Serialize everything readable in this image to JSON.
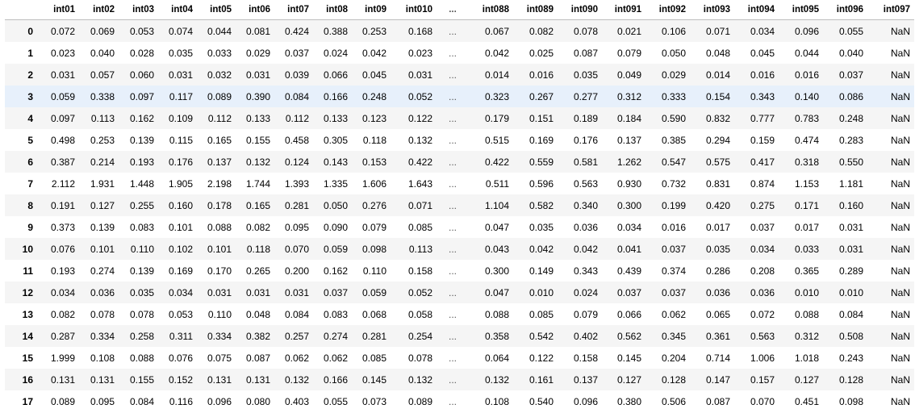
{
  "columns": [
    "int01",
    "int02",
    "int03",
    "int04",
    "int05",
    "int06",
    "int07",
    "int08",
    "int09",
    "int010",
    "...",
    "int088",
    "int089",
    "int090",
    "int091",
    "int092",
    "int093",
    "int094",
    "int095",
    "int096",
    "int097"
  ],
  "rows": [
    {
      "index": "0",
      "cells": [
        "0.072",
        "0.069",
        "0.053",
        "0.074",
        "0.044",
        "0.081",
        "0.424",
        "0.388",
        "0.253",
        "0.168",
        "...",
        "0.067",
        "0.082",
        "0.078",
        "0.021",
        "0.106",
        "0.071",
        "0.034",
        "0.096",
        "0.055",
        "NaN"
      ]
    },
    {
      "index": "1",
      "cells": [
        "0.023",
        "0.040",
        "0.028",
        "0.035",
        "0.033",
        "0.029",
        "0.037",
        "0.024",
        "0.042",
        "0.023",
        "...",
        "0.042",
        "0.025",
        "0.087",
        "0.079",
        "0.050",
        "0.048",
        "0.045",
        "0.044",
        "0.040",
        "NaN"
      ]
    },
    {
      "index": "2",
      "cells": [
        "0.031",
        "0.057",
        "0.060",
        "0.031",
        "0.032",
        "0.031",
        "0.039",
        "0.066",
        "0.045",
        "0.031",
        "...",
        "0.014",
        "0.016",
        "0.035",
        "0.049",
        "0.029",
        "0.014",
        "0.016",
        "0.016",
        "0.037",
        "NaN"
      ]
    },
    {
      "index": "3",
      "cells": [
        "0.059",
        "0.338",
        "0.097",
        "0.117",
        "0.089",
        "0.390",
        "0.084",
        "0.166",
        "0.248",
        "0.052",
        "...",
        "0.323",
        "0.267",
        "0.277",
        "0.312",
        "0.333",
        "0.154",
        "0.343",
        "0.140",
        "0.086",
        "NaN"
      ]
    },
    {
      "index": "4",
      "cells": [
        "0.097",
        "0.113",
        "0.162",
        "0.109",
        "0.112",
        "0.133",
        "0.112",
        "0.133",
        "0.123",
        "0.122",
        "...",
        "0.179",
        "0.151",
        "0.189",
        "0.184",
        "0.590",
        "0.832",
        "0.777",
        "0.783",
        "0.248",
        "NaN"
      ]
    },
    {
      "index": "5",
      "cells": [
        "0.498",
        "0.253",
        "0.139",
        "0.115",
        "0.165",
        "0.155",
        "0.458",
        "0.305",
        "0.118",
        "0.132",
        "...",
        "0.515",
        "0.169",
        "0.176",
        "0.137",
        "0.385",
        "0.294",
        "0.159",
        "0.474",
        "0.283",
        "NaN"
      ]
    },
    {
      "index": "6",
      "cells": [
        "0.387",
        "0.214",
        "0.193",
        "0.176",
        "0.137",
        "0.132",
        "0.124",
        "0.143",
        "0.153",
        "0.422",
        "...",
        "0.422",
        "0.559",
        "0.581",
        "1.262",
        "0.547",
        "0.575",
        "0.417",
        "0.318",
        "0.550",
        "NaN"
      ]
    },
    {
      "index": "7",
      "cells": [
        "2.112",
        "1.931",
        "1.448",
        "1.905",
        "2.198",
        "1.744",
        "1.393",
        "1.335",
        "1.606",
        "1.643",
        "...",
        "0.511",
        "0.596",
        "0.563",
        "0.930",
        "0.732",
        "0.831",
        "0.874",
        "1.153",
        "1.181",
        "NaN"
      ]
    },
    {
      "index": "8",
      "cells": [
        "0.191",
        "0.127",
        "0.255",
        "0.160",
        "0.178",
        "0.165",
        "0.281",
        "0.050",
        "0.276",
        "0.071",
        "...",
        "1.104",
        "0.582",
        "0.340",
        "0.300",
        "0.199",
        "0.420",
        "0.275",
        "0.171",
        "0.160",
        "NaN"
      ]
    },
    {
      "index": "9",
      "cells": [
        "0.373",
        "0.139",
        "0.083",
        "0.101",
        "0.088",
        "0.082",
        "0.095",
        "0.090",
        "0.079",
        "0.085",
        "...",
        "0.047",
        "0.035",
        "0.036",
        "0.034",
        "0.016",
        "0.017",
        "0.037",
        "0.017",
        "0.031",
        "NaN"
      ]
    },
    {
      "index": "10",
      "cells": [
        "0.076",
        "0.101",
        "0.110",
        "0.102",
        "0.101",
        "0.118",
        "0.070",
        "0.059",
        "0.098",
        "0.113",
        "...",
        "0.043",
        "0.042",
        "0.042",
        "0.041",
        "0.037",
        "0.035",
        "0.034",
        "0.033",
        "0.031",
        "NaN"
      ]
    },
    {
      "index": "11",
      "cells": [
        "0.193",
        "0.274",
        "0.139",
        "0.169",
        "0.170",
        "0.265",
        "0.200",
        "0.162",
        "0.110",
        "0.158",
        "...",
        "0.300",
        "0.149",
        "0.343",
        "0.439",
        "0.374",
        "0.286",
        "0.208",
        "0.365",
        "0.289",
        "NaN"
      ]
    },
    {
      "index": "12",
      "cells": [
        "0.034",
        "0.036",
        "0.035",
        "0.034",
        "0.031",
        "0.031",
        "0.031",
        "0.037",
        "0.059",
        "0.052",
        "...",
        "0.047",
        "0.010",
        "0.024",
        "0.037",
        "0.037",
        "0.036",
        "0.036",
        "0.010",
        "0.010",
        "NaN"
      ]
    },
    {
      "index": "13",
      "cells": [
        "0.082",
        "0.078",
        "0.078",
        "0.053",
        "0.110",
        "0.048",
        "0.084",
        "0.083",
        "0.068",
        "0.058",
        "...",
        "0.088",
        "0.085",
        "0.079",
        "0.066",
        "0.062",
        "0.065",
        "0.072",
        "0.088",
        "0.084",
        "NaN"
      ]
    },
    {
      "index": "14",
      "cells": [
        "0.287",
        "0.334",
        "0.258",
        "0.311",
        "0.334",
        "0.382",
        "0.257",
        "0.274",
        "0.281",
        "0.254",
        "...",
        "0.358",
        "0.542",
        "0.402",
        "0.562",
        "0.345",
        "0.361",
        "0.563",
        "0.312",
        "0.508",
        "NaN"
      ]
    },
    {
      "index": "15",
      "cells": [
        "1.999",
        "0.108",
        "0.088",
        "0.076",
        "0.075",
        "0.087",
        "0.062",
        "0.062",
        "0.085",
        "0.078",
        "...",
        "0.064",
        "0.122",
        "0.158",
        "0.145",
        "0.204",
        "0.714",
        "1.006",
        "1.018",
        "0.243",
        "NaN"
      ]
    },
    {
      "index": "16",
      "cells": [
        "0.131",
        "0.131",
        "0.155",
        "0.152",
        "0.131",
        "0.131",
        "0.132",
        "0.166",
        "0.145",
        "0.132",
        "...",
        "0.132",
        "0.161",
        "0.137",
        "0.127",
        "0.128",
        "0.147",
        "0.157",
        "0.127",
        "0.128",
        "NaN"
      ]
    },
    {
      "index": "17",
      "cells": [
        "0.089",
        "0.095",
        "0.084",
        "0.116",
        "0.096",
        "0.080",
        "0.403",
        "0.055",
        "0.073",
        "0.089",
        "...",
        "0.108",
        "0.540",
        "0.096",
        "0.380",
        "0.506",
        "0.087",
        "0.070",
        "0.451",
        "0.098",
        "NaN"
      ]
    }
  ],
  "highlighted_row": "3"
}
